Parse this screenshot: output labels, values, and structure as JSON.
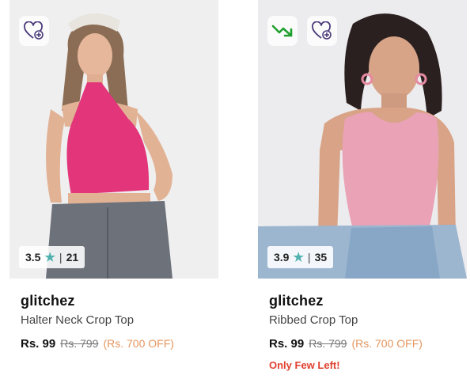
{
  "products": [
    {
      "brand": "glitchez",
      "title": "Halter Neck Crop Top",
      "price": "Rs. 99",
      "mrp": "Rs. 799",
      "discount": "(Rs. 700 OFF)",
      "rating": "3.5",
      "reviews": "21",
      "stock_note": "",
      "has_trend_icon": false,
      "top_color": "#e2357a"
    },
    {
      "brand": "glitchez",
      "title": "Ribbed Crop Top",
      "price": "Rs. 99",
      "mrp": "Rs. 799",
      "discount": "(Rs. 700 OFF)",
      "rating": "3.9",
      "reviews": "35",
      "stock_note": "Only Few Left!",
      "has_trend_icon": true,
      "top_color": "#eaa2b6"
    }
  ],
  "icons": {
    "wishlist": "heart-plus-icon",
    "price_trend": "trend-down-icon",
    "rating_star": "star-icon"
  },
  "colors": {
    "rating_star": "#4fb2b0",
    "discount": "#e5965f",
    "stock_warning": "#e0402e",
    "trend_down": "#1fa02e"
  }
}
